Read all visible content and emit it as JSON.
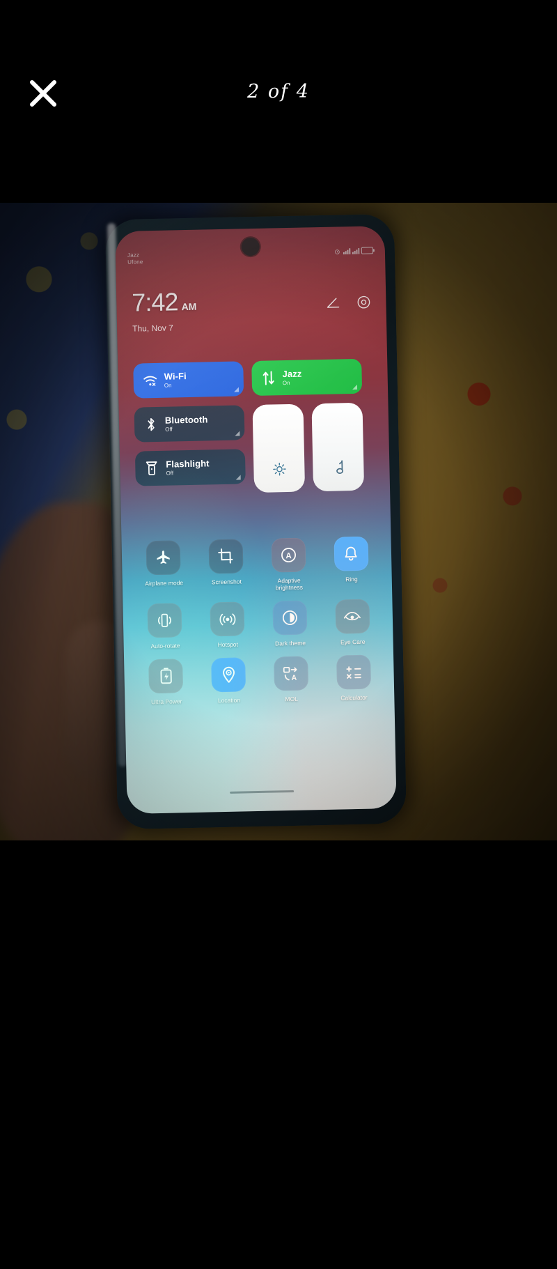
{
  "viewer": {
    "close_icon": "close-icon",
    "counter": "2 of 4"
  },
  "photo": {
    "description": "hand-holding-phone-on-bedsheet",
    "phone": {
      "status_bar": {
        "carrier_1": "Jazz",
        "carrier_2": "Ufone",
        "icons": [
          "alarm-icon",
          "signal-icon",
          "signal-icon",
          "battery-icon"
        ]
      },
      "clock": {
        "time": "7:42",
        "ampm": "AM",
        "date": "Thu, Nov 7",
        "edit_icon": "edit-icon",
        "settings_icon": "eye-settings-icon"
      },
      "big_tiles": [
        {
          "name": "wifi",
          "title": "Wi-Fi",
          "state": "On",
          "icon": "wifi-icon",
          "color": "#3371e8"
        },
        {
          "name": "mobile-data",
          "title": "Jazz",
          "state": "On",
          "icon": "data-arrows-icon",
          "color": "#2ec951"
        },
        {
          "name": "bluetooth",
          "title": "Bluetooth",
          "state": "Off",
          "icon": "bluetooth-icon",
          "color": "#143e4e"
        },
        {
          "name": "flashlight",
          "title": "Flashlight",
          "state": "Off",
          "icon": "flashlight-icon",
          "color": "#143e4e"
        }
      ],
      "sliders": [
        {
          "name": "brightness",
          "icon": "brightness-sun-icon"
        },
        {
          "name": "volume",
          "icon": "music-note-icon"
        }
      ],
      "grid": [
        {
          "label": "Airplane mode",
          "icon": "airplane-icon",
          "style": "b-dim"
        },
        {
          "label": "Screenshot",
          "icon": "screenshot-icon",
          "style": "b-dim"
        },
        {
          "label": "Adaptive brightness",
          "icon": "adaptive-brightness-icon",
          "style": "b-warm"
        },
        {
          "label": "Ring",
          "icon": "bell-icon",
          "style": "b-blue"
        },
        {
          "label": "Auto-rotate",
          "icon": "auto-rotate-icon",
          "style": "b-gray"
        },
        {
          "label": "Hotspot",
          "icon": "hotspot-icon",
          "style": "b-gray"
        },
        {
          "label": "Dark theme",
          "icon": "dark-theme-icon",
          "style": "b-bluesoft"
        },
        {
          "label": "Eye Care",
          "icon": "eye-care-icon",
          "style": "b-gray"
        },
        {
          "label": "Ultra Power",
          "icon": "battery-saver-icon",
          "style": "b-gray"
        },
        {
          "label": "Location",
          "icon": "location-pin-icon",
          "style": "b-blue"
        },
        {
          "label": "MOL",
          "icon": "translate-icon",
          "style": "b-steel"
        },
        {
          "label": "Calculator",
          "icon": "calculator-icon",
          "style": "b-steel"
        }
      ]
    }
  }
}
